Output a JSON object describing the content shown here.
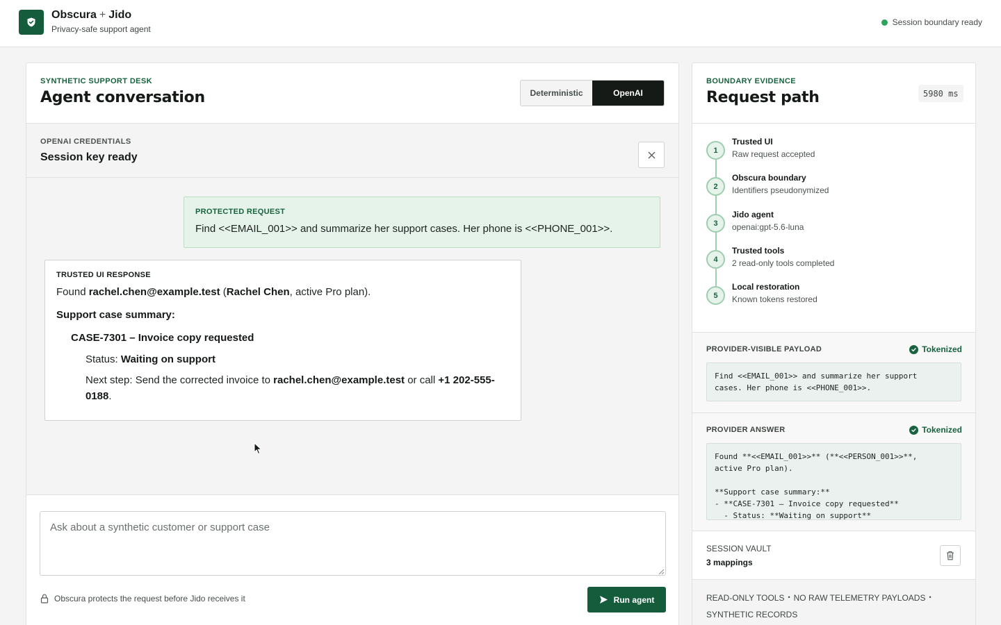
{
  "header": {
    "brand_left": "Obscura",
    "brand_plus": "+",
    "brand_right": "Jido",
    "subtitle": "Privacy-safe support agent",
    "session_status": "Session boundary ready",
    "status_color": "#2fa35e"
  },
  "conversation": {
    "eyebrow": "SYNTHETIC SUPPORT DESK",
    "title": "Agent conversation",
    "modes": [
      "Deterministic",
      "OpenAI"
    ],
    "active_mode": "OpenAI",
    "credentials": {
      "eyebrow": "OPENAI CREDENTIALS",
      "status": "Session key ready",
      "close_icon": "close-icon"
    },
    "protected_request": {
      "label": "PROTECTED REQUEST",
      "text": "Find <<EMAIL_001>> and summarize her support cases. Her phone is <<PHONE_001>>."
    },
    "response": {
      "label": "TRUSTED UI RESPONSE",
      "found_prefix": "Found ",
      "email": "rachel.chen@example.test",
      "open_paren": " (",
      "name": "Rachel Chen",
      "plan_suffix": ", active Pro plan).",
      "summary_heading": "Support case summary:",
      "case_title": "CASE-7301 – Invoice copy requested",
      "status_prefix": "Status: ",
      "status_value": "Waiting on support",
      "next_prefix": "Next step: Send the corrected invoice to ",
      "next_email": "rachel.chen@example.test",
      "next_mid": " or call ",
      "phone": "+1 202-555-0188",
      "next_end": "."
    },
    "composer": {
      "placeholder": "Ask about a synthetic customer or support case",
      "value": "",
      "protect_note": "Obscura protects the request before Jido receives it",
      "run_label": "Run agent"
    }
  },
  "evidence": {
    "eyebrow": "BOUNDARY EVIDENCE",
    "title": "Request path",
    "latency": "5980 ms",
    "steps": [
      {
        "num": "1",
        "title": "Trusted UI",
        "detail": "Raw request accepted"
      },
      {
        "num": "2",
        "title": "Obscura boundary",
        "detail": "Identifiers pseudonymized"
      },
      {
        "num": "3",
        "title": "Jido agent",
        "detail": "openai:gpt-5.6-luna"
      },
      {
        "num": "4",
        "title": "Trusted tools",
        "detail": "2 read-only tools completed"
      },
      {
        "num": "5",
        "title": "Local restoration",
        "detail": "Known tokens restored"
      }
    ],
    "provider_payload": {
      "label": "PROVIDER-VISIBLE PAYLOAD",
      "badge": "Tokenized",
      "code": "Find <<EMAIL_001>> and summarize her support\ncases. Her phone is <<PHONE_001>>."
    },
    "provider_answer": {
      "label": "PROVIDER ANSWER",
      "badge": "Tokenized",
      "code": "Found **<<EMAIL_001>>** (**<<PERSON_001>>**,\nactive Pro plan).\n\n**Support case summary:**\n- **CASE-7301 – Invoice copy requested**\n  - Status: **Waiting on support**\n  - Next step: Send the corrected invoice"
    },
    "vault": {
      "label": "SESSION VAULT",
      "count": "3 mappings"
    },
    "footer_tags": [
      "READ-ONLY TOOLS",
      "NO RAW TELEMETRY PAYLOADS",
      "SYNTHETIC RECORDS"
    ]
  }
}
